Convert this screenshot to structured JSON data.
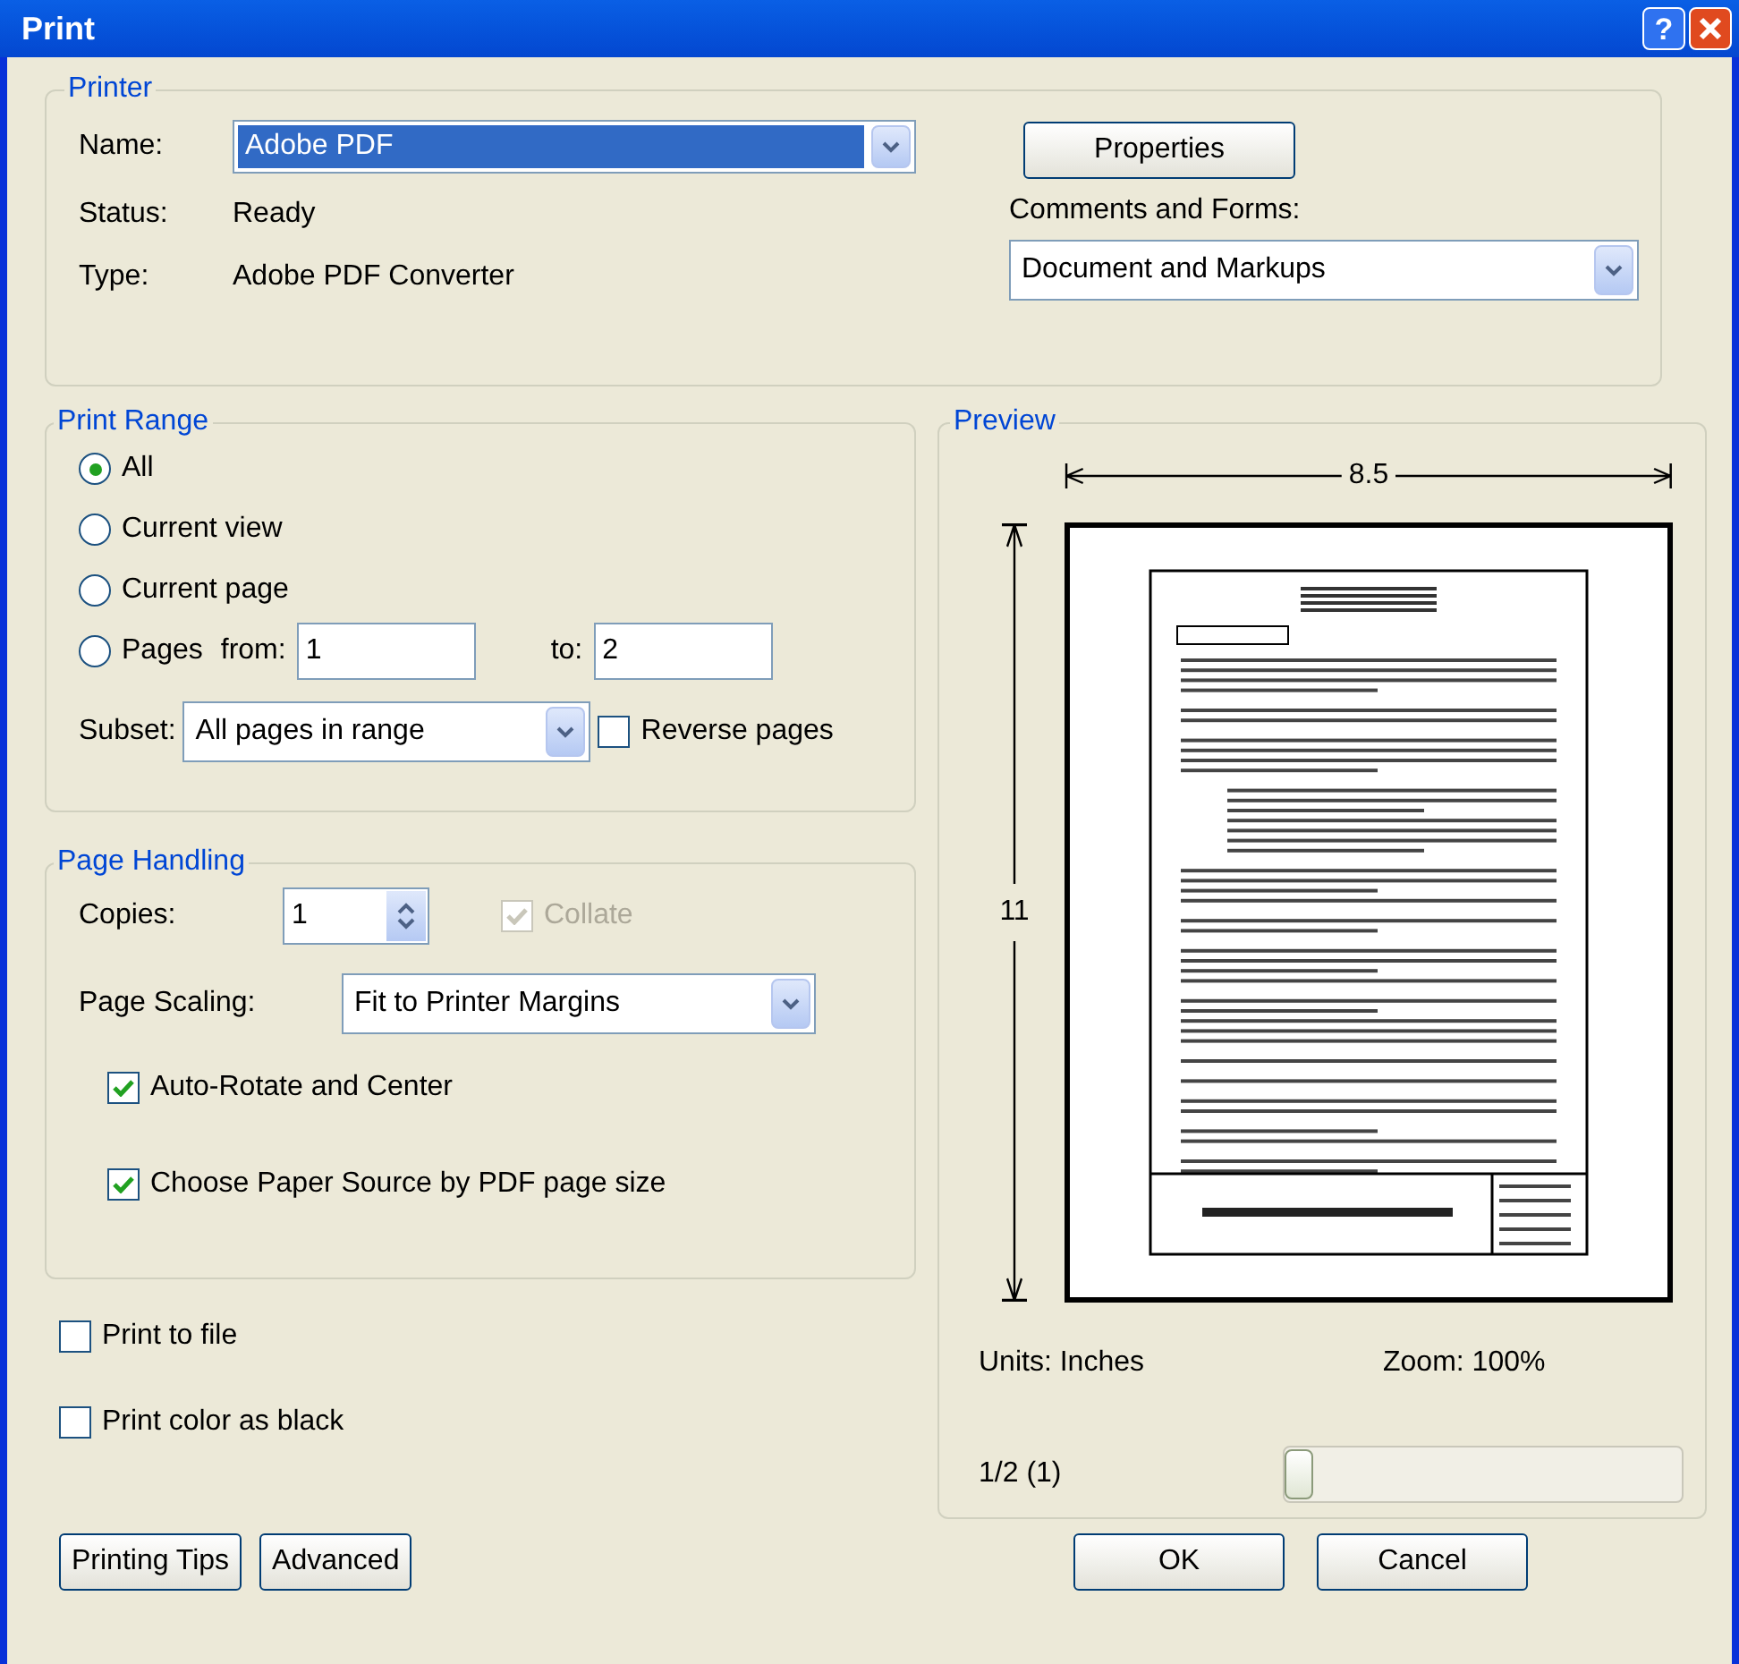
{
  "window": {
    "title": "Print",
    "help_button": "?"
  },
  "printer": {
    "legend": "Printer",
    "name_label": "Name:",
    "name_value": "Adobe PDF",
    "status_label": "Status:",
    "status_value": "Ready",
    "type_label": "Type:",
    "type_value": "Adobe PDF Converter",
    "properties_button": "Properties",
    "comments_label": "Comments and Forms:",
    "comments_value": "Document and Markups"
  },
  "print_range": {
    "legend": "Print Range",
    "options": [
      {
        "label": "All",
        "selected": true
      },
      {
        "label": "Current view",
        "selected": false
      },
      {
        "label": "Current page",
        "selected": false
      },
      {
        "label": "Pages",
        "selected": false
      }
    ],
    "from_label": "from:",
    "from_value": "1",
    "to_label": "to:",
    "to_value": "2",
    "subset_label": "Subset:",
    "subset_value": "All pages in range",
    "reverse": {
      "label": "Reverse pages",
      "checked": false
    }
  },
  "page_handling": {
    "legend": "Page Handling",
    "copies_label": "Copies:",
    "copies_value": "1",
    "collate": {
      "label": "Collate",
      "checked": true,
      "disabled": true
    },
    "scaling_label": "Page Scaling:",
    "scaling_value": "Fit to Printer Margins",
    "options": [
      {
        "label": "Auto-Rotate and Center",
        "checked": true
      },
      {
        "label": "Choose Paper Source by PDF page size",
        "checked": true
      }
    ]
  },
  "extra_options": [
    {
      "label": "Print to file",
      "checked": false
    },
    {
      "label": "Print color as black",
      "checked": false
    }
  ],
  "preview": {
    "legend": "Preview",
    "width_label": "8.5",
    "height_label": "11",
    "units": "Units: Inches",
    "zoom": "Zoom: 100%",
    "page": "1/2 (1)",
    "level": 0
  },
  "buttons_left": [
    "Printing Tips",
    "Advanced"
  ],
  "buttons_right": [
    "OK",
    "Cancel"
  ]
}
